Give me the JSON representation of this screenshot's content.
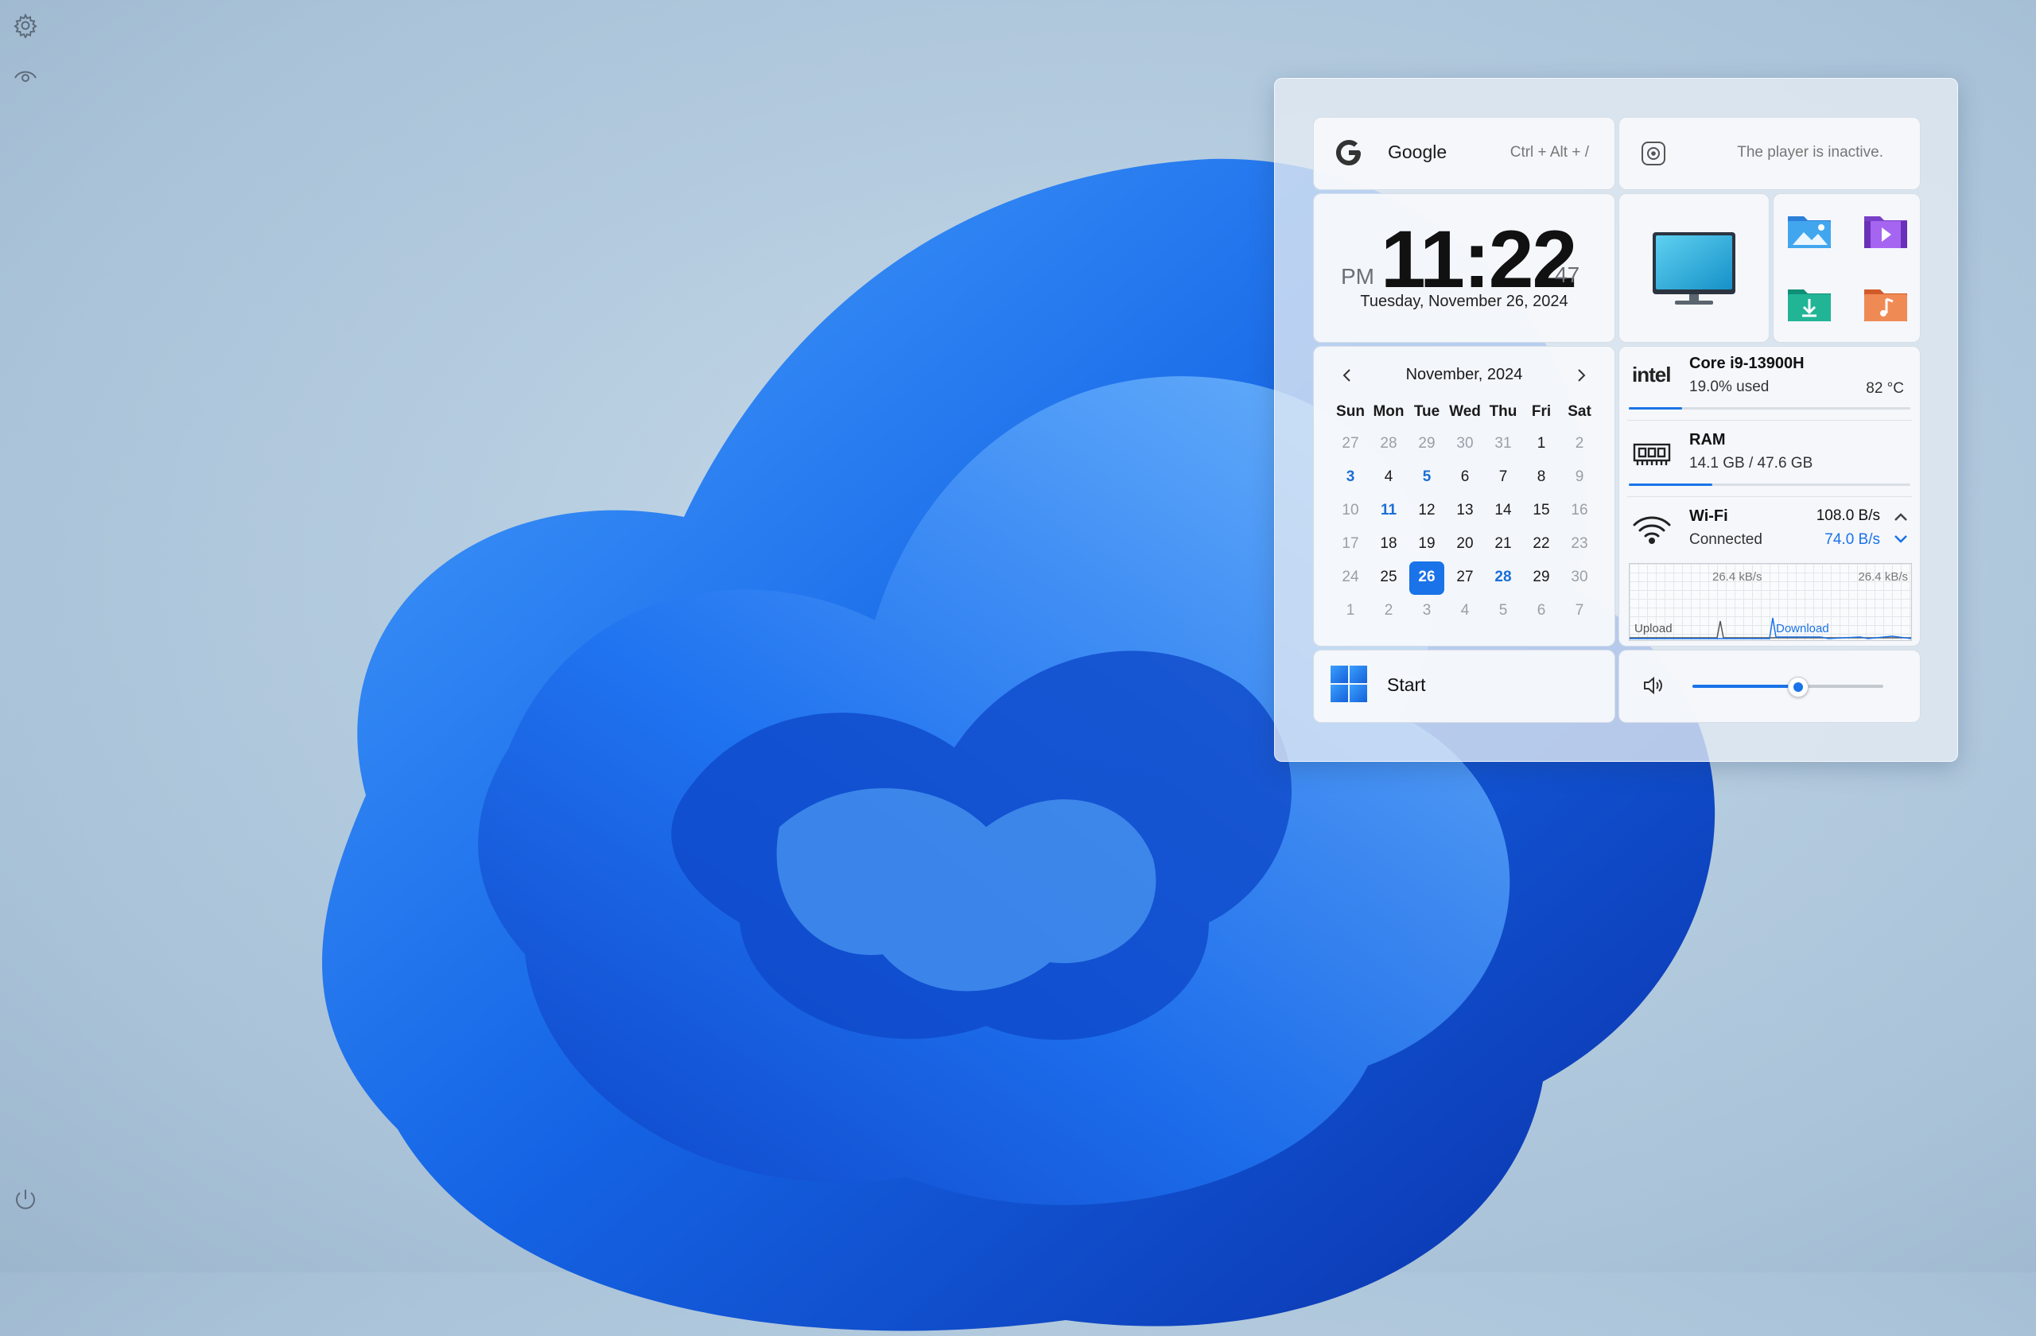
{
  "rail": {
    "settings_icon": "gear-icon",
    "eye_icon": "eye-icon",
    "power_icon": "power-icon"
  },
  "search": {
    "label": "Google",
    "hint": "Ctrl + Alt + /"
  },
  "player": {
    "status": "The player is inactive."
  },
  "clock": {
    "ampm": "PM",
    "time": "11:22",
    "seconds": "47",
    "date": "Tuesday, November 26, 2024"
  },
  "folders": [
    "pictures-folder-icon",
    "videos-folder-icon",
    "downloads-folder-icon",
    "music-folder-icon"
  ],
  "calendar": {
    "month_label": "November, 2024",
    "weekdays": [
      "Sun",
      "Mon",
      "Tue",
      "Wed",
      "Thu",
      "Fri",
      "Sat"
    ],
    "days": [
      {
        "d": "27",
        "t": "other"
      },
      {
        "d": "28",
        "t": "other"
      },
      {
        "d": "29",
        "t": "other"
      },
      {
        "d": "30",
        "t": "other"
      },
      {
        "d": "31",
        "t": "other"
      },
      {
        "d": "1",
        "t": ""
      },
      {
        "d": "2",
        "t": "other"
      },
      {
        "d": "3",
        "t": "hl"
      },
      {
        "d": "4",
        "t": ""
      },
      {
        "d": "5",
        "t": "hl"
      },
      {
        "d": "6",
        "t": ""
      },
      {
        "d": "7",
        "t": ""
      },
      {
        "d": "8",
        "t": ""
      },
      {
        "d": "9",
        "t": "other"
      },
      {
        "d": "10",
        "t": "other"
      },
      {
        "d": "11",
        "t": "hl"
      },
      {
        "d": "12",
        "t": ""
      },
      {
        "d": "13",
        "t": ""
      },
      {
        "d": "14",
        "t": ""
      },
      {
        "d": "15",
        "t": ""
      },
      {
        "d": "16",
        "t": "other"
      },
      {
        "d": "17",
        "t": "other"
      },
      {
        "d": "18",
        "t": ""
      },
      {
        "d": "19",
        "t": ""
      },
      {
        "d": "20",
        "t": ""
      },
      {
        "d": "21",
        "t": ""
      },
      {
        "d": "22",
        "t": ""
      },
      {
        "d": "23",
        "t": "other"
      },
      {
        "d": "24",
        "t": "other"
      },
      {
        "d": "25",
        "t": ""
      },
      {
        "d": "26",
        "t": "today"
      },
      {
        "d": "27",
        "t": ""
      },
      {
        "d": "28",
        "t": "hl"
      },
      {
        "d": "29",
        "t": ""
      },
      {
        "d": "30",
        "t": "other"
      },
      {
        "d": "1",
        "t": "other"
      },
      {
        "d": "2",
        "t": "other"
      },
      {
        "d": "3",
        "t": "other"
      },
      {
        "d": "4",
        "t": "other"
      },
      {
        "d": "5",
        "t": "other"
      },
      {
        "d": "6",
        "t": "other"
      },
      {
        "d": "7",
        "t": "other"
      }
    ]
  },
  "system": {
    "cpu": {
      "brand": "intel",
      "name": "Core i9-13900H",
      "usage": "19.0% used",
      "temp": "82 °C",
      "usage_fraction": 0.19
    },
    "ram": {
      "name": "RAM",
      "usage": "14.1 GB / 47.6 GB",
      "usage_fraction": 0.296
    },
    "wifi": {
      "name": "Wi-Fi",
      "status": "Connected",
      "upload": "108.0 B/s",
      "download": "74.0 B/s"
    },
    "graph": {
      "upload_label": "Upload",
      "download_label": "Download",
      "upload_max": "26.4 kB/s",
      "download_max": "26.4 kB/s"
    }
  },
  "start": {
    "label": "Start"
  },
  "volume": {
    "level": 0.55
  },
  "colors": {
    "accent": "#1a73e8"
  }
}
